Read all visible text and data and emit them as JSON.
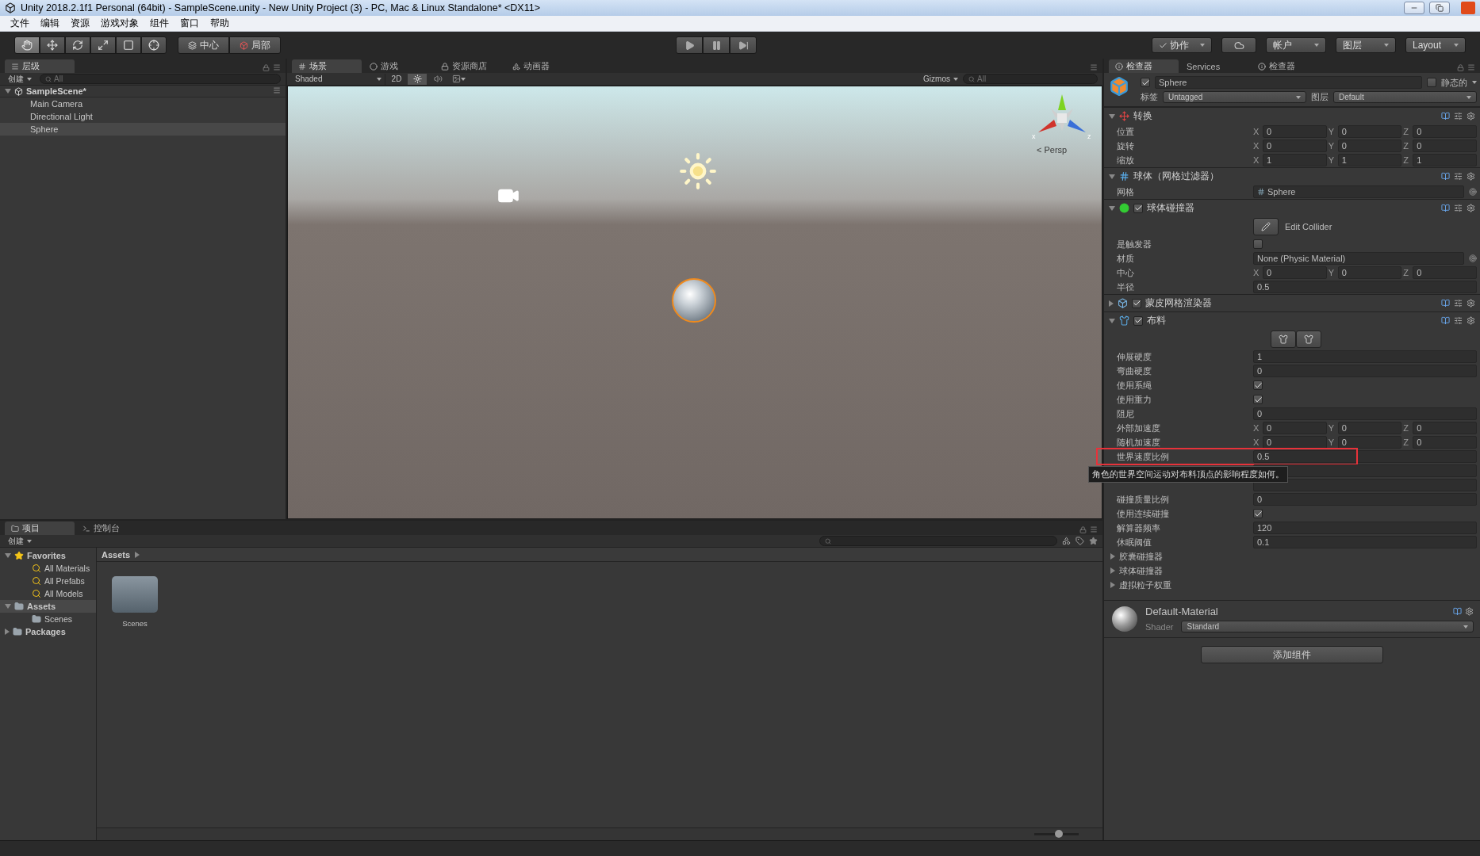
{
  "window": {
    "title": "Unity 2018.2.1f1 Personal (64bit) - SampleScene.unity - New Unity Project (3) - PC, Mac & Linux Standalone* <DX11>"
  },
  "menu": [
    "文件",
    "编辑",
    "资源",
    "游戏对象",
    "组件",
    "窗口",
    "帮助"
  ],
  "toolbar": {
    "tools": [
      {
        "selected": true
      },
      {
        "selected": false
      },
      {
        "selected": false
      },
      {
        "selected": false
      },
      {
        "selected": false
      },
      {
        "selected": false
      }
    ],
    "pivot": [
      "中心",
      "局部"
    ],
    "right": [
      {
        "kind": "collab",
        "label": "协作"
      },
      {
        "kind": "cloud"
      },
      {
        "kind": "dropdown",
        "label": "帐户"
      },
      {
        "kind": "dropdown",
        "label": "图层"
      },
      {
        "kind": "dropdown",
        "label": "Layout"
      }
    ]
  },
  "hierarchy": {
    "tab": "层级",
    "create": "创建",
    "search_placeholder": "All",
    "scene": "SampleScene*",
    "items": [
      {
        "label": "Main Camera",
        "selected": false
      },
      {
        "label": "Directional Light",
        "selected": false
      },
      {
        "label": "Sphere",
        "selected": true
      }
    ]
  },
  "scene_view": {
    "tabs": [
      {
        "label": "场景",
        "selected": true
      },
      {
        "label": "游戏",
        "selected": false
      },
      {
        "label": "资源商店",
        "selected": false
      },
      {
        "label": "动画器",
        "selected": false
      }
    ],
    "shading": "Shaded",
    "mode_2d": "2D",
    "toggles": [
      {
        "on": true
      },
      {
        "on": false
      },
      {
        "on": false
      }
    ],
    "gizmos": "Gizmos",
    "search_placeholder": "All",
    "axis_labels": [
      "x",
      "z"
    ],
    "projection": "< Persp"
  },
  "inspector": {
    "tabs": [
      {
        "label": "检查器",
        "selected": true
      },
      {
        "label": "Services",
        "selected": false
      },
      {
        "label": "检查器",
        "selected": false
      }
    ],
    "object": {
      "name": "Sphere",
      "active": true,
      "static_label": "静态的",
      "static": false,
      "tag_label": "标签",
      "tag": "Untagged",
      "layer_label": "图层",
      "layer": "Default"
    },
    "components": [
      {
        "kind": "transform",
        "title": "转换",
        "expanded": true,
        "rows": [
          {
            "kind": "vector",
            "label": "位置",
            "axes": [
              "X",
              "Y",
              "Z"
            ],
            "values": [
              "0",
              "0",
              "0"
            ]
          },
          {
            "kind": "vector",
            "label": "旋转",
            "axes": [
              "X",
              "Y",
              "Z"
            ],
            "values": [
              "0",
              "0",
              "0"
            ]
          },
          {
            "kind": "vector",
            "label": "缩放",
            "axes": [
              "X",
              "Y",
              "Z"
            ],
            "values": [
              "1",
              "1",
              "1"
            ]
          }
        ]
      },
      {
        "kind": "mesh_filter",
        "title": "球体（网格过滤器）",
        "expanded": true,
        "rows": [
          {
            "kind": "object",
            "label": "网格",
            "value": "Sphere"
          }
        ]
      },
      {
        "kind": "sphere_collider",
        "title": "球体碰撞器",
        "enabled": true,
        "expanded": true,
        "rows": [
          {
            "kind": "edit_button",
            "value": "Edit Collider"
          },
          {
            "kind": "checkbox",
            "label": "是触发器",
            "checked": false
          },
          {
            "kind": "object",
            "label": "材质",
            "value": "None (Physic Material)"
          },
          {
            "kind": "vector",
            "label": "中心",
            "axes": [
              "X",
              "Y",
              "Z"
            ],
            "values": [
              "0",
              "0",
              "0"
            ]
          },
          {
            "kind": "number",
            "label": "半径",
            "value": "0.5"
          }
        ]
      },
      {
        "kind": "skinned_mesh_renderer",
        "title": "蒙皮网格渲染器",
        "enabled": true,
        "expanded": false
      },
      {
        "kind": "cloth",
        "title": "布料",
        "enabled": true,
        "expanded": true,
        "rows": [
          {
            "kind": "tool_buttons"
          },
          {
            "kind": "number",
            "label": "伸展硬度",
            "value": "1"
          },
          {
            "kind": "number",
            "label": "弯曲硬度",
            "value": "0"
          },
          {
            "kind": "checkbox",
            "label": "使用系绳",
            "checked": true
          },
          {
            "kind": "checkbox",
            "label": "使用重力",
            "checked": true
          },
          {
            "kind": "number",
            "label": "阻尼",
            "value": "0"
          },
          {
            "kind": "vector",
            "label": "外部加速度",
            "axes": [
              "X",
              "Y",
              "Z"
            ],
            "values": [
              "0",
              "0",
              "0"
            ]
          },
          {
            "kind": "vector",
            "label": "随机加速度",
            "axes": [
              "X",
              "Y",
              "Z"
            ],
            "values": [
              "0",
              "0",
              "0"
            ]
          },
          {
            "kind": "number",
            "label": "世界速度比例",
            "value": "0.5",
            "highlighted": true,
            "tooltip": "角色的世界空间运动对布料顶点的影响程度如何。"
          },
          {
            "kind": "obscured"
          },
          {
            "kind": "obscured"
          },
          {
            "kind": "number",
            "label": "碰撞质量比例",
            "value": "0"
          },
          {
            "kind": "checkbox",
            "label": "使用连续碰撞",
            "checked": true
          },
          {
            "kind": "number",
            "label": "解算器频率",
            "value": "120"
          },
          {
            "kind": "number",
            "label": "休眠阈值",
            "value": "0.1"
          },
          {
            "kind": "foldout",
            "label": "胶囊碰撞器"
          },
          {
            "kind": "foldout",
            "label": "球体碰撞器"
          },
          {
            "kind": "foldout",
            "label": "虚拟粒子权重"
          }
        ]
      }
    ],
    "material": {
      "name": "Default-Material",
      "shader_label": "Shader",
      "shader": "Standard"
    },
    "add_component": "添加组件"
  },
  "project": {
    "tabs": [
      {
        "label": "项目",
        "selected": true
      },
      {
        "label": "控制台",
        "selected": false
      }
    ],
    "create": "创建",
    "tree": [
      {
        "kind": "favorites",
        "label": "Favorites",
        "expanded": true,
        "selected": false,
        "children": [
          {
            "kind": "search",
            "label": "All Materials",
            "selected": false
          },
          {
            "kind": "search",
            "label": "All Prefabs",
            "selected": false
          },
          {
            "kind": "search",
            "label": "All Models",
            "selected": false
          }
        ]
      },
      {
        "kind": "folder",
        "label": "Assets",
        "expanded": true,
        "selected": true,
        "children": [
          {
            "kind": "folder",
            "label": "Scenes",
            "selected": false
          }
        ]
      },
      {
        "kind": "folder",
        "label": "Packages",
        "expanded": false,
        "selected": false
      }
    ],
    "breadcrumb": "Assets",
    "items": [
      {
        "label": "Scenes"
      }
    ],
    "icon_size": {
      "level": 0.55
    }
  }
}
